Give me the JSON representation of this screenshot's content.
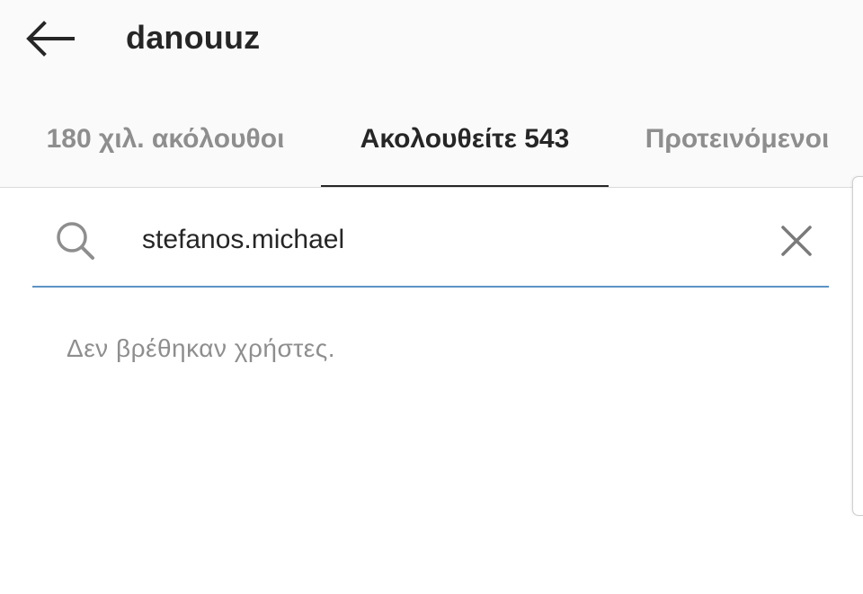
{
  "header": {
    "title": "danouuz",
    "back_icon": "arrow-left-icon"
  },
  "tabs": [
    {
      "label": "180 χιλ. ακόλουθοι",
      "active": false
    },
    {
      "label": "Ακολουθείτε 543",
      "active": true
    },
    {
      "label": "Προτεινόμενοι",
      "active": false
    }
  ],
  "search": {
    "value": "stefanos.michael",
    "icon": "search-icon",
    "clear_icon": "close-icon"
  },
  "results": {
    "empty_message": "Δεν βρέθηκαν χρήστες."
  },
  "colors": {
    "header_bg": "#fafafa",
    "text_primary": "#262626",
    "text_secondary": "#8e8e8e",
    "search_underline": "#5b93c4"
  }
}
